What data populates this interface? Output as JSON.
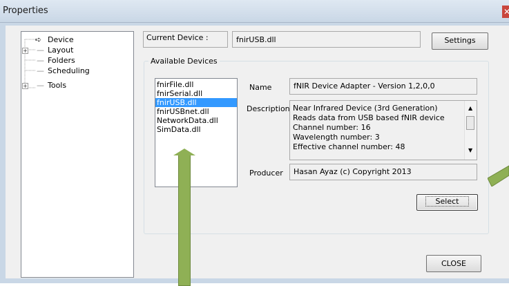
{
  "window": {
    "title": "Properties",
    "close_glyph": "✕"
  },
  "tree": {
    "items": [
      {
        "label": "Device",
        "expandable": false,
        "selected": true,
        "glyph": "➪"
      },
      {
        "label": "Layout",
        "expandable": true,
        "glyph": "⊞"
      },
      {
        "label": "Folders",
        "expandable": false
      },
      {
        "label": "Scheduling",
        "expandable": false
      },
      {
        "label": "Tools",
        "expandable": true,
        "glyph": "⊞"
      }
    ]
  },
  "current_device": {
    "label": "Current Device :",
    "value": "fnirUSB.dll",
    "settings_label": "Settings"
  },
  "available_devices": {
    "title": "Available Devices",
    "list": [
      "fnirFile.dll",
      "fnirSerial.dll",
      "fnirUSB.dll",
      "fnirUSBnet.dll",
      "NetworkData.dll",
      "SimData.dll"
    ],
    "selected_index": 2
  },
  "details": {
    "name_label": "Name",
    "name_value": "fNIR Device Adapter - Version 1,2,0,0",
    "description_label": "Description",
    "description_lines": [
      "Near Infrared Device (3rd Generation)",
      "Reads data from USB based fNIR device",
      "Channel number: 16",
      "Wavelength number: 3",
      "Effective channel number: 48"
    ],
    "producer_label": "Producer",
    "producer_value": "Hasan Ayaz (c) Copyright 2013",
    "select_label": "Select"
  },
  "close_label": "CLOSE",
  "colors": {
    "selection": "#3399ff",
    "arrow": "#8fb055",
    "titlebar": "#c9d7e6"
  }
}
